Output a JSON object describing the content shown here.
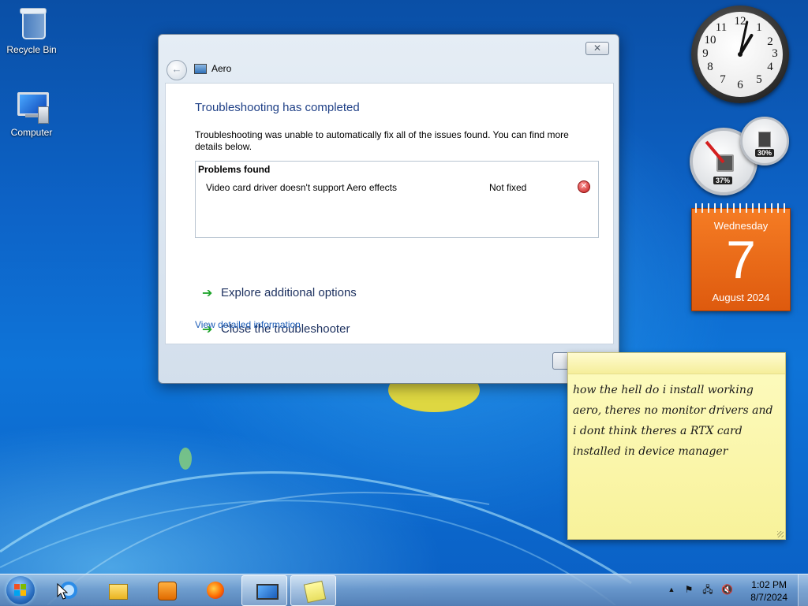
{
  "desktop": {
    "icons": [
      {
        "label": "Recycle Bin",
        "icon": "recycle-bin-icon"
      },
      {
        "label": "Computer",
        "icon": "computer-icon"
      }
    ]
  },
  "dialog": {
    "close_glyph": "✕",
    "back_glyph": "←",
    "title": "Aero",
    "heading": "Troubleshooting has completed",
    "description": "Troubleshooting was unable to automatically fix all of the issues found. You can find more details below.",
    "problems_header": "Problems found",
    "problems": [
      {
        "name": "Video card driver doesn't support Aero effects",
        "status": "Not fixed",
        "icon": "error-icon",
        "icon_glyph": "✕"
      }
    ],
    "links": [
      {
        "label": "Explore additional options",
        "icon": "green-arrow-icon",
        "glyph": "➔"
      },
      {
        "label": "Close the troubleshooter",
        "icon": "green-arrow-icon",
        "glyph": "➔"
      }
    ],
    "detail_link": "View detailed information"
  },
  "gadgets": {
    "clock": {
      "numbers": [
        "12",
        "1",
        "2",
        "3",
        "4",
        "5",
        "6",
        "7",
        "8",
        "9",
        "10",
        "11"
      ],
      "hour": 1,
      "minute": 2
    },
    "meters": {
      "cpu_percent": "37%",
      "memory_percent": "30%"
    },
    "calendar": {
      "weekday": "Wednesday",
      "day": "7",
      "month_year": "August 2024"
    }
  },
  "sticky_note": {
    "text": "how the hell do i install working aero, theres no monitor drivers and i dont think theres a RTX card installed in device manager"
  },
  "taskbar": {
    "items": [
      {
        "icon": "internet-explorer-icon"
      },
      {
        "icon": "windows-explorer-icon"
      },
      {
        "icon": "media-player-icon"
      },
      {
        "icon": "firefox-icon"
      },
      {
        "icon": "display-settings-icon"
      },
      {
        "icon": "sticky-notes-icon"
      }
    ],
    "tray": {
      "time": "1:02 PM",
      "date": "8/7/2024",
      "chevron": "▲",
      "flag_glyph": "⚑",
      "network_glyph": "🖧",
      "volume_glyph": "🔇"
    }
  },
  "colors": {
    "accent": "#1e3f86",
    "link": "#1f5fb8",
    "calendar": "#f57c24",
    "sticky": "#fdfbc0"
  }
}
